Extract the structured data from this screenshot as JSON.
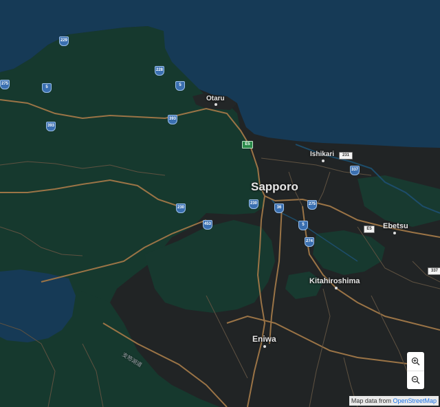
{
  "map": {
    "places": {
      "sapporo": "Sapporo",
      "otaru": "Otaru",
      "ishikari": "Ishikari",
      "ebetsu": "Ebetsu",
      "kitahiroshima": "Kitahiroshima",
      "eniwa": "Eniwa"
    },
    "lake_label": "支笏湖道",
    "route_shields": [
      "229",
      "228",
      "5",
      "5",
      "393",
      "393",
      "275",
      "5",
      "230",
      "230",
      "36",
      "453",
      "275",
      "5",
      "274",
      "337"
    ],
    "expressway_shields": [
      "E5",
      "E5"
    ],
    "pref_road_shields": [
      "231",
      "337"
    ]
  },
  "controls": {
    "zoom_in_icon": "zoom-in-magnifier",
    "zoom_out_icon": "zoom-out-magnifier"
  },
  "attribution": {
    "prefix": "Map data from ",
    "link": "OpenStreetMap"
  },
  "colors": {
    "sea": "#163a56",
    "forest": "#16392e",
    "land": "#212425",
    "road_major": "#9b7446",
    "road_minor": "#6a5a45",
    "shield_blue": "#3a6fb0"
  }
}
